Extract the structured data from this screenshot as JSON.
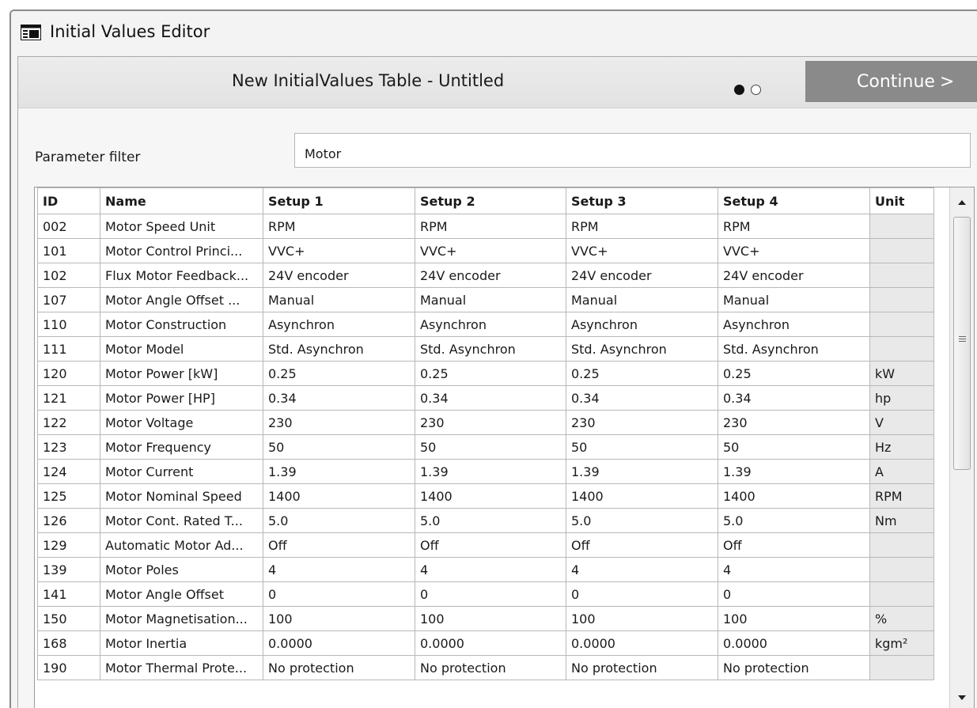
{
  "window": {
    "title": "Initial Values Editor",
    "icon": "table-icon"
  },
  "header": {
    "table_title": "New InitialValues Table - Untitled",
    "step_indicator": {
      "total": 2,
      "current": 1
    },
    "continue_label": "Continue",
    "continue_arrow": ">"
  },
  "filter": {
    "label": "Parameter filter",
    "value": "Motor"
  },
  "table": {
    "columns": [
      "ID",
      "Name",
      "Setup 1",
      "Setup 2",
      "Setup 3",
      "Setup 4",
      "Unit"
    ],
    "rows": [
      [
        "002",
        "Motor Speed Unit",
        "RPM",
        "RPM",
        "RPM",
        "RPM",
        ""
      ],
      [
        "101",
        "Motor Control Princi...",
        "VVC+",
        "VVC+",
        "VVC+",
        "VVC+",
        ""
      ],
      [
        "102",
        "Flux Motor Feedback...",
        "24V encoder",
        "24V encoder",
        "24V encoder",
        "24V encoder",
        ""
      ],
      [
        "107",
        "Motor Angle Offset ...",
        "Manual",
        "Manual",
        "Manual",
        "Manual",
        ""
      ],
      [
        "110",
        "Motor Construction",
        "Asynchron",
        "Asynchron",
        "Asynchron",
        "Asynchron",
        ""
      ],
      [
        "111",
        "Motor Model",
        "Std. Asynchron",
        "Std. Asynchron",
        "Std. Asynchron",
        "Std. Asynchron",
        ""
      ],
      [
        "120",
        "Motor Power [kW]",
        "0.25",
        "0.25",
        "0.25",
        "0.25",
        "kW"
      ],
      [
        "121",
        "Motor Power [HP]",
        "0.34",
        "0.34",
        "0.34",
        "0.34",
        "hp"
      ],
      [
        "122",
        "Motor Voltage",
        "230",
        "230",
        "230",
        "230",
        "V"
      ],
      [
        "123",
        "Motor Frequency",
        "50",
        "50",
        "50",
        "50",
        "Hz"
      ],
      [
        "124",
        "Motor Current",
        "1.39",
        "1.39",
        "1.39",
        "1.39",
        "A"
      ],
      [
        "125",
        "Motor Nominal Speed",
        "1400",
        "1400",
        "1400",
        "1400",
        "RPM"
      ],
      [
        "126",
        "Motor Cont. Rated T...",
        "5.0",
        "5.0",
        "5.0",
        "5.0",
        "Nm"
      ],
      [
        "129",
        "Automatic Motor Ad...",
        "Off",
        "Off",
        "Off",
        "Off",
        ""
      ],
      [
        "139",
        "Motor Poles",
        "4",
        "4",
        "4",
        "4",
        ""
      ],
      [
        "141",
        "Motor Angle Offset",
        "0",
        "0",
        "0",
        "0",
        ""
      ],
      [
        "150",
        "Motor Magnetisation...",
        "100",
        "100",
        "100",
        "100",
        "%"
      ],
      [
        "168",
        "Motor Inertia",
        "0.0000",
        "0.0000",
        "0.0000",
        "0.0000",
        "kgm²"
      ],
      [
        "190",
        "Motor Thermal Prote...",
        "No protection",
        "No protection",
        "No protection",
        "No protection",
        ""
      ]
    ]
  },
  "colors": {
    "continue_button": "#8a8a8a",
    "unit_column": "#e9e9e9",
    "header_band": "#e6e6e6"
  }
}
